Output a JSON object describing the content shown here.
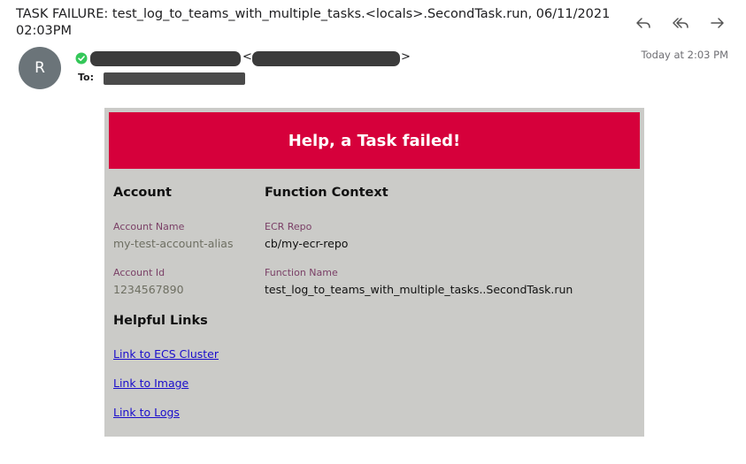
{
  "email": {
    "subject": "TASK FAILURE: test_log_to_teams_with_multiple_tasks.<locals>.SecondTask.run, 06/11/2021 02:03PM",
    "avatar_initial": "R",
    "sender_open": "<",
    "sender_close": ">",
    "to_label": "To:",
    "date": "Today at 2:03 PM"
  },
  "toolbar": {
    "icons": [
      "reply-icon",
      "reply-all-icon",
      "forward-icon"
    ]
  },
  "card": {
    "banner": "Help, a Task failed!",
    "account_heading": "Account",
    "account_name_label": "Account Name",
    "account_name_value": "my-test-account-alias",
    "account_id_label": "Account Id",
    "account_id_value": "1234567890",
    "links_heading": "Helpful Links",
    "links": [
      "Link to ECS Cluster",
      "Link to Image",
      "Link to Logs"
    ],
    "function_heading": "Function Context",
    "ecr_repo_label": "ECR Repo",
    "ecr_repo_value": "cb/my-ecr-repo",
    "function_name_label": "Function Name",
    "function_name_value": "test_log_to_teams_with_multiple_tasks..SecondTask.run"
  },
  "colors": {
    "banner": "#d6003b",
    "card_bg": "#cbcbc8",
    "label": "#7a3f66",
    "link": "#1a0dcc",
    "verified": "#34c759",
    "avatar": "#6b7479"
  }
}
